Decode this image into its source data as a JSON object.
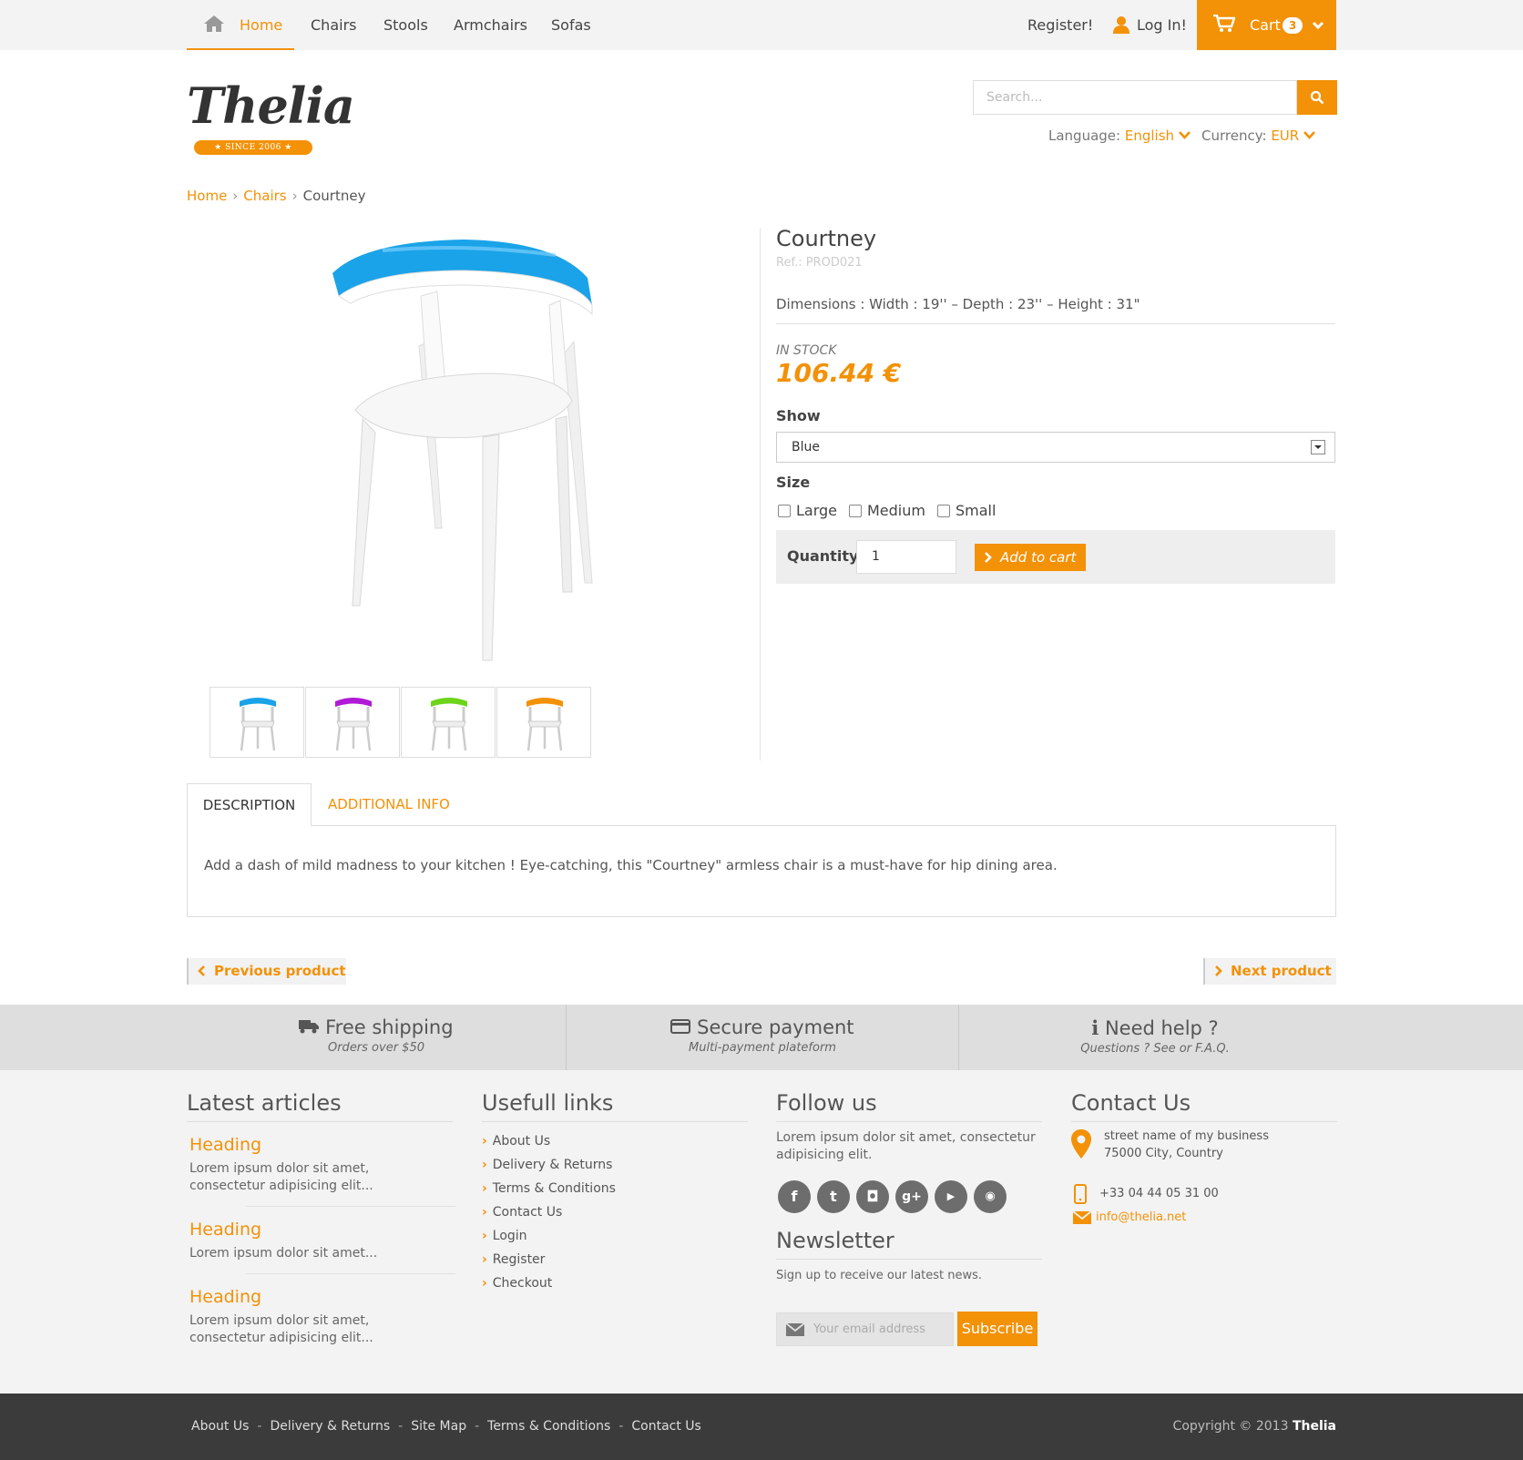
{
  "nav": {
    "items": [
      "Home",
      "Chairs",
      "Stools",
      "Armchairs",
      "Sofas"
    ],
    "register": "Register!",
    "login": "Log In!",
    "cart_label": "Cart",
    "cart_count": "3"
  },
  "header": {
    "logo_text": "Thelia",
    "logo_since": "★ SINCE 2006 ★",
    "search_placeholder": "Search...",
    "language_label": "Language:",
    "language_value": "English",
    "currency_label": "Currency:",
    "currency_value": "EUR"
  },
  "breadcrumb": [
    "Home",
    "Chairs",
    "Courtney"
  ],
  "product": {
    "title": "Courtney",
    "ref": "Ref.: PROD021",
    "dimensions": "Dimensions : Width : 19'' – Depth : 23'' – Height : 31\"",
    "stock": "IN STOCK",
    "price": "106.44 €",
    "show_label": "Show",
    "show_value": "Blue",
    "size_label": "Size",
    "sizes": [
      "Large",
      "Medium",
      "Small"
    ],
    "quantity_label": "Quantity",
    "quantity_value": "1",
    "add_to_cart": "Add to cart",
    "thumb_colors": [
      "#1aa3e8",
      "#b01ad6",
      "#6dd41a",
      "#f39107"
    ]
  },
  "tabs": {
    "description": "DESCRIPTION",
    "additional": "ADDITIONAL INFO",
    "description_text": "Add a dash of mild madness to your kitchen ! Eye-catching, this \"Courtney\" armless chair is a must-have for hip dining area."
  },
  "pager": {
    "previous": "Previous product",
    "next": "Next product"
  },
  "features": [
    {
      "title": "Free shipping",
      "sub": "Orders over $50"
    },
    {
      "title": "Secure payment",
      "sub": "Multi-payment plateform"
    },
    {
      "title": "Need help ?",
      "sub": "Questions ? See or F.A.Q."
    }
  ],
  "footer": {
    "articles_title": "Latest articles",
    "articles": [
      {
        "heading": "Heading",
        "text": "Lorem ipsum dolor sit amet, consectetur adipisicing elit..."
      },
      {
        "heading": "Heading",
        "text": "Lorem ipsum dolor sit amet..."
      },
      {
        "heading": "Heading",
        "text": "Lorem ipsum dolor sit amet, consectetur adipisicing elit..."
      }
    ],
    "links_title": "Usefull links",
    "links": [
      "About Us",
      "Delivery & Returns",
      "Terms & Conditions",
      "Contact Us",
      "Login",
      "Register",
      "Checkout"
    ],
    "follow_title": "Follow us",
    "follow_text": "Lorem ipsum dolor sit amet, consectetur adipisicing elit.",
    "newsletter_title": "Newsletter",
    "newsletter_text": "Sign up to receive our latest news.",
    "newsletter_placeholder": "Your email address",
    "subscribe": "Subscribe",
    "contact_title": "Contact Us",
    "address_line1": "street name of my business",
    "address_line2": "75000 City, Country",
    "phone": "+33 04 44 05 31 00",
    "email": "info@thelia.net"
  },
  "bottom": {
    "links": [
      "About Us",
      "Delivery & Returns",
      "Site Map",
      "Terms & Conditions",
      "Contact Us"
    ],
    "copyright": "Copyright © 2013",
    "brand": "Thelia"
  }
}
